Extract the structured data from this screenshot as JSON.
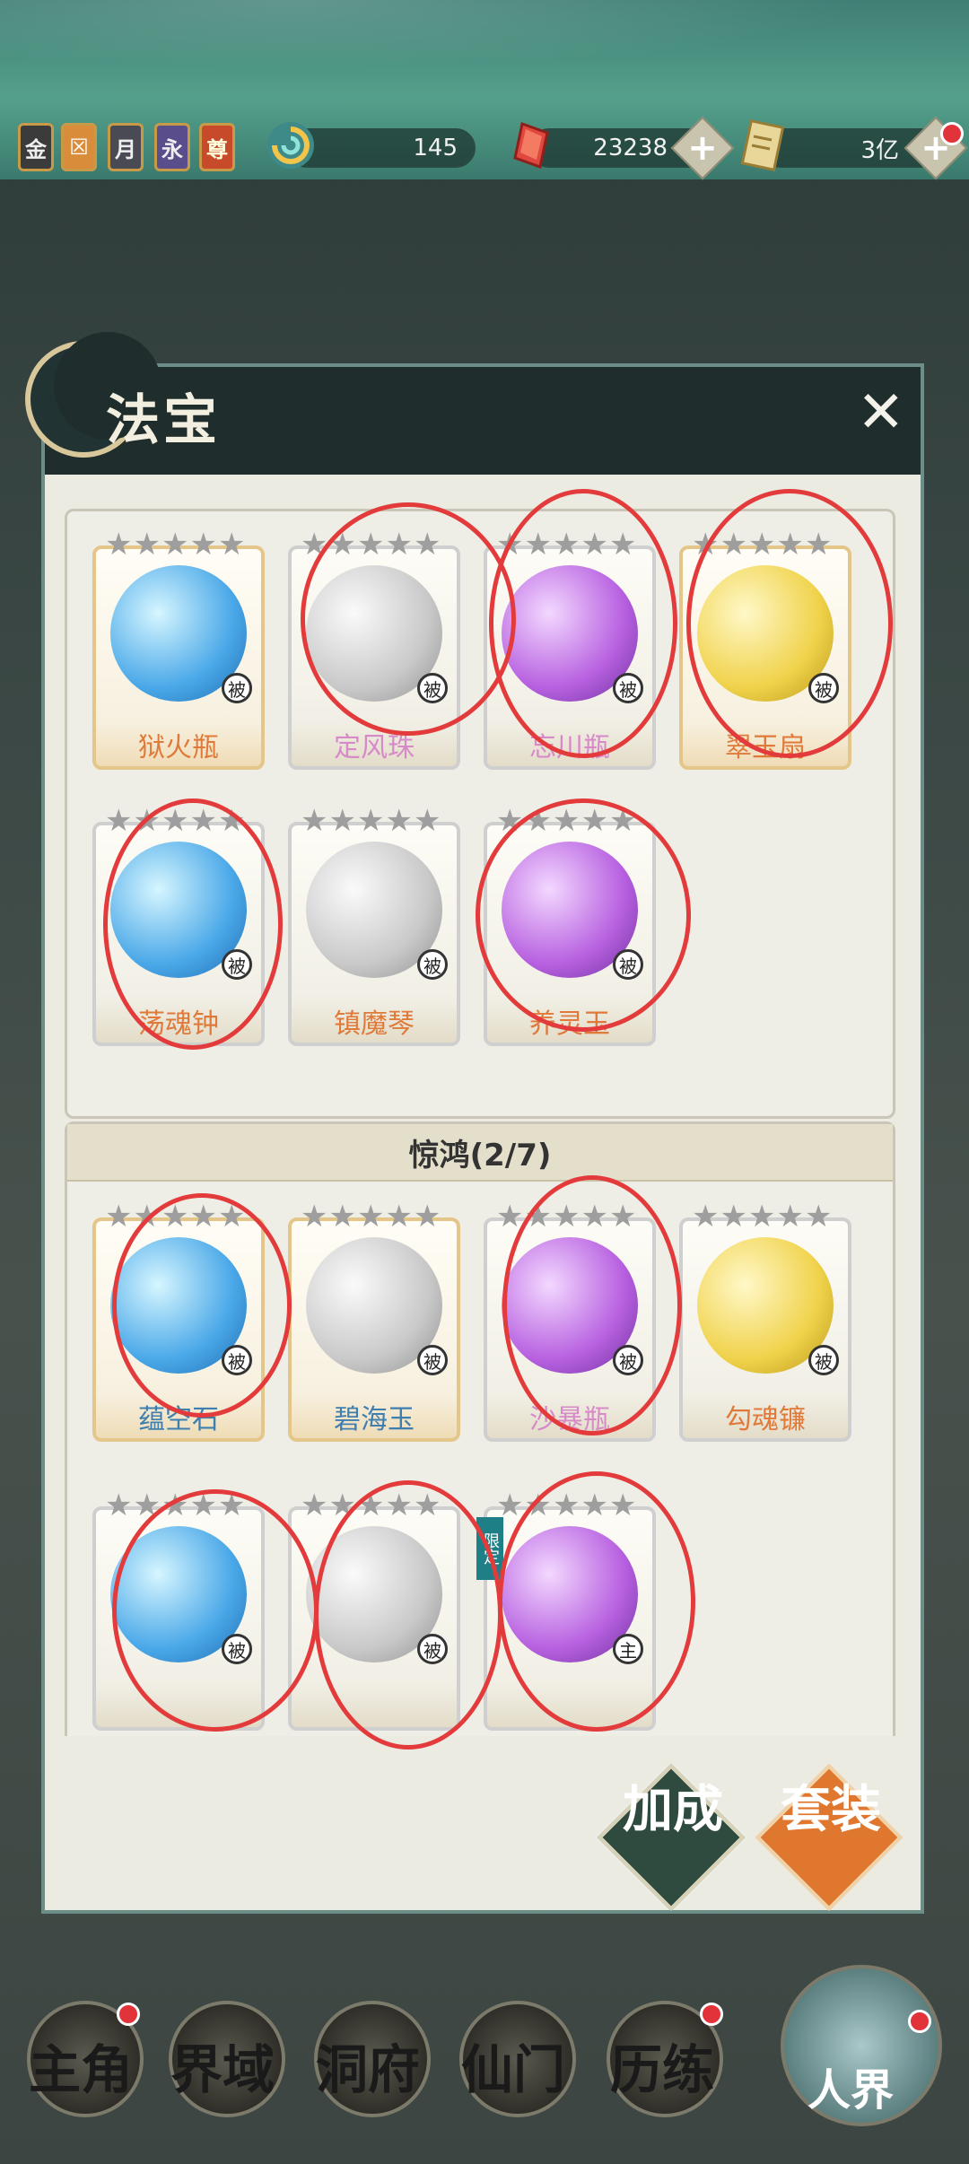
{
  "topbar": {
    "badges": [
      "金",
      "☒",
      "月",
      "永",
      "尊"
    ],
    "currency1": {
      "icon": "spiral-coin-icon",
      "value": "145"
    },
    "currency2": {
      "icon": "red-crystal-icon",
      "value": "23238"
    },
    "currency3": {
      "icon": "scroll-icon",
      "value": "3亿"
    },
    "plus_label": "+"
  },
  "panel": {
    "title": "法宝",
    "close_label": "✕"
  },
  "section1": {
    "items": [
      {
        "name": "狱火瓶",
        "color": "#e07a3a",
        "tag": "被"
      },
      {
        "name": "定风珠",
        "color": "#d78ac8",
        "tag": "被"
      },
      {
        "name": "忘川瓶",
        "color": "#d78ac8",
        "tag": "被"
      },
      {
        "name": "翠玉扇",
        "color": "#e07a3a",
        "tag": "被"
      },
      {
        "name": "荡魂钟",
        "color": "#e07a3a",
        "tag": "被"
      },
      {
        "name": "镇魔琴",
        "color": "#e07a3a",
        "tag": "被"
      },
      {
        "name": "养灵玉",
        "color": "#e07a3a",
        "tag": "被"
      }
    ]
  },
  "section2": {
    "title": "惊鸿(2/7)",
    "items": [
      {
        "name": "蕴空石",
        "color": "#3e7fb0",
        "tag": "被"
      },
      {
        "name": "碧海玉",
        "color": "#3e7fb0",
        "tag": "被"
      },
      {
        "name": "沙暴瓶",
        "color": "#d78ac8",
        "tag": "被"
      },
      {
        "name": "勾魂镰",
        "color": "#e07a3a",
        "tag": "被"
      },
      {
        "name": "",
        "color": "#e07a3a",
        "tag": "被"
      },
      {
        "name": "",
        "color": "#e07a3a",
        "tag": "被"
      },
      {
        "name": "",
        "color": "#e07a3a",
        "tag": "主",
        "limited": "限定"
      }
    ]
  },
  "buttons": {
    "bonus": "加成",
    "set": "套装"
  },
  "nav": [
    "主角",
    "界域",
    "洞府",
    "仙门",
    "历练",
    "人界"
  ]
}
